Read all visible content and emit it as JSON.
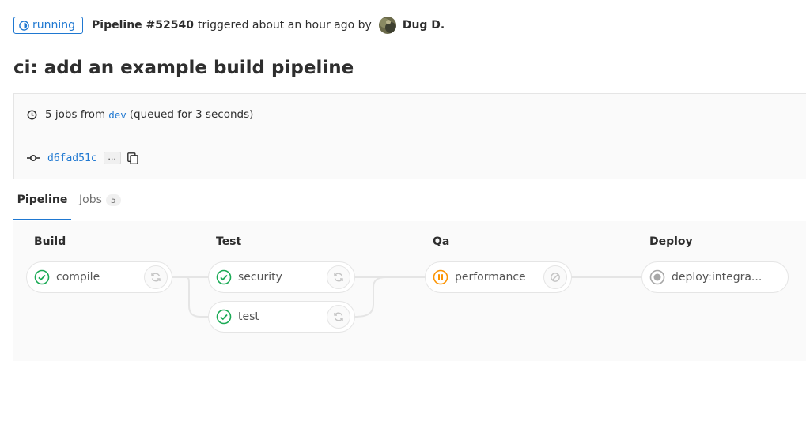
{
  "header": {
    "status": "running",
    "pipeline_label": "Pipeline #52540",
    "triggered_text": "triggered about an hour ago by",
    "user_name": "Dug D."
  },
  "title": "ci: add an example build pipeline",
  "info": {
    "jobs_text": "5 jobs from",
    "branch": "dev",
    "queued_text": "(queued for 3 seconds)",
    "commit_sha": "d6fad51c",
    "ellipsis": "..."
  },
  "tabs": {
    "pipeline": "Pipeline",
    "jobs": "Jobs",
    "jobs_count": "5"
  },
  "stages": [
    {
      "name": "Build",
      "jobs": [
        {
          "name": "compile",
          "status": "success",
          "action": "retry"
        }
      ]
    },
    {
      "name": "Test",
      "jobs": [
        {
          "name": "security",
          "status": "success",
          "action": "retry"
        },
        {
          "name": "test",
          "status": "success",
          "action": "retry"
        }
      ]
    },
    {
      "name": "Qa",
      "jobs": [
        {
          "name": "performance",
          "status": "manual-paused",
          "action": "cancel"
        }
      ]
    },
    {
      "name": "Deploy",
      "jobs": [
        {
          "name": "deploy:integra...",
          "status": "created",
          "action": "none"
        }
      ]
    }
  ],
  "colors": {
    "running": "#1f78d1",
    "success": "#1aaa55",
    "paused": "#fc9403",
    "created": "#a7a7a7",
    "link": "#1f78d1"
  },
  "icons": {
    "status_running": "running-status-icon",
    "clock": "clock-icon",
    "commit": "commit-icon",
    "copy": "clipboard-icon",
    "success": "check-circle-icon",
    "paused": "pause-circle-icon",
    "created": "created-circle-icon",
    "retry": "retry-icon",
    "cancel": "cancel-icon"
  }
}
